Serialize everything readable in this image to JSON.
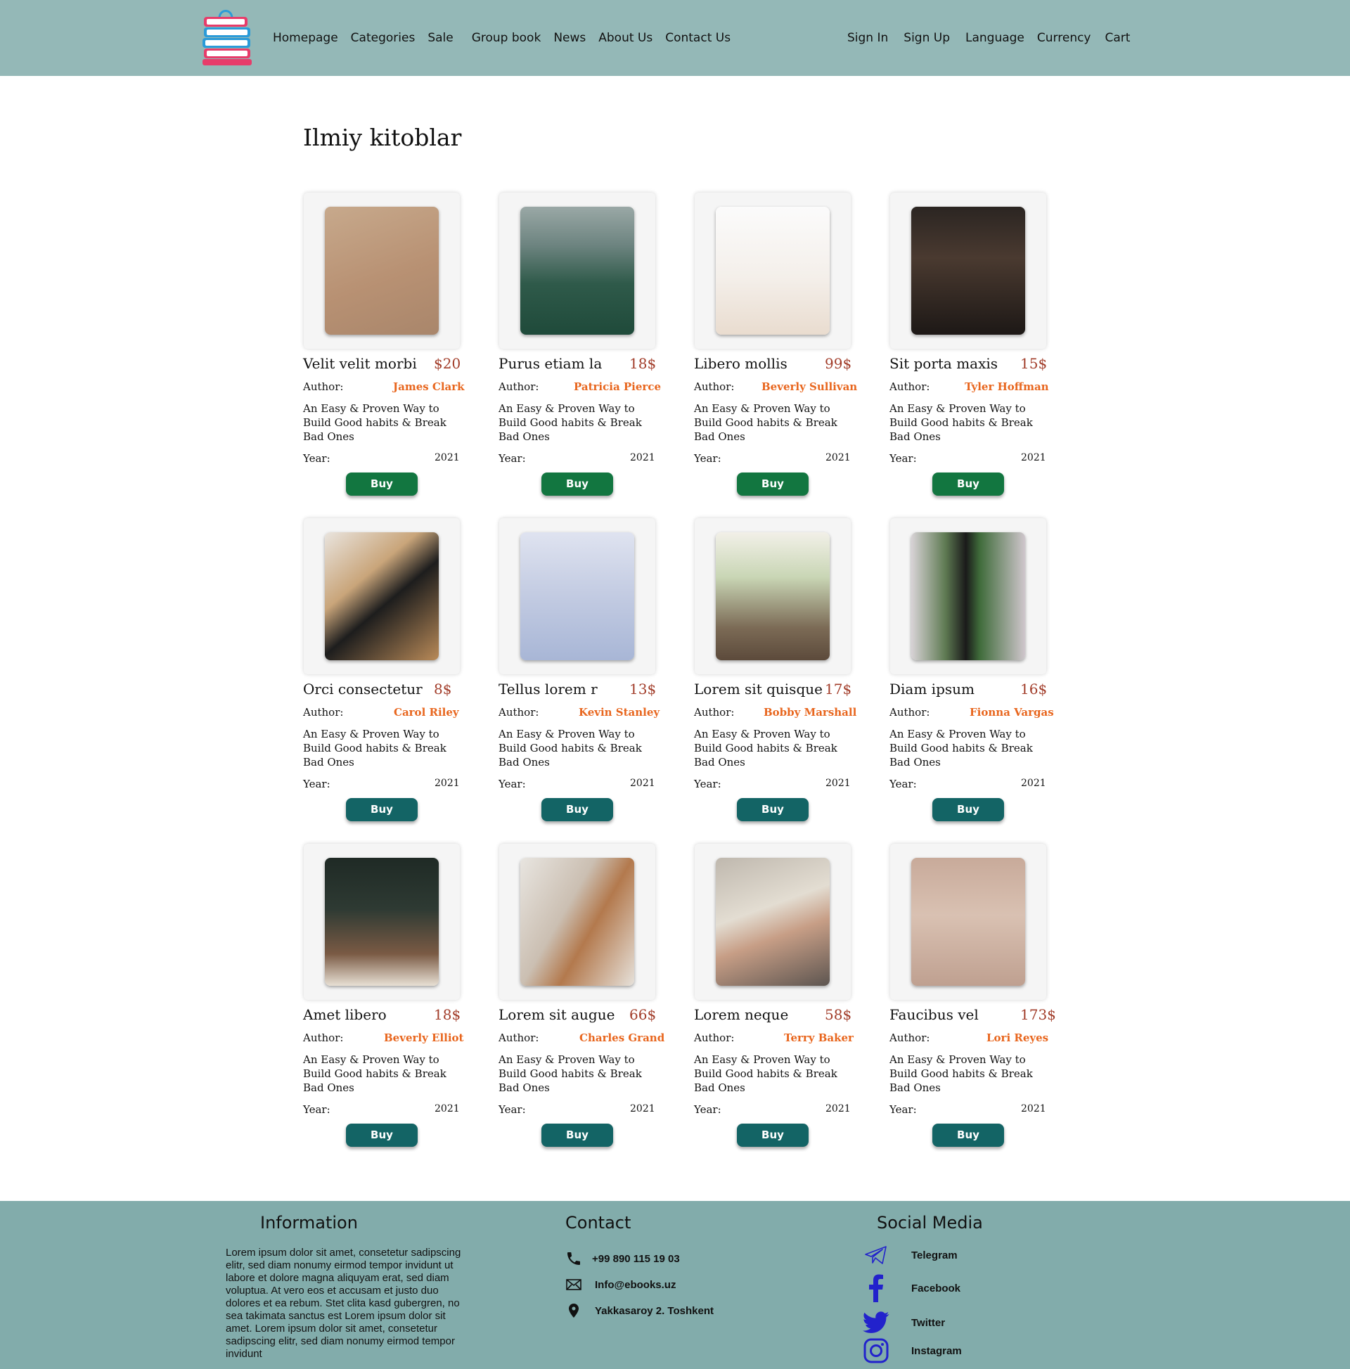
{
  "header": {
    "nav_left": [
      "Homepage",
      "Categories",
      "Sale",
      "Group book",
      "News",
      "About Us",
      "Contact Us"
    ],
    "nav_right": [
      "Sign In",
      "Sign Up",
      "Language",
      "Currency",
      "Cart"
    ]
  },
  "section": {
    "title": "Ilmiy kitoblar"
  },
  "labels": {
    "author": "Author:",
    "year": "Year:",
    "buy": "Buy"
  },
  "books": [
    {
      "title": "Velit velit morbi",
      "price": "$20",
      "author": "James Clark",
      "description": "An Easy & Proven Way to Build Good habits & Break Bad Ones",
      "year": "2021",
      "image": "open-book-on-stack"
    },
    {
      "title": "Purus etiam la",
      "price": "18$",
      "author": "Patricia Pierce",
      "description": "An Easy & Proven Way to Build Good habits & Break Bad Ones",
      "year": "2021",
      "image": "book-over-foggy-forest"
    },
    {
      "title": "Libero mollis",
      "price": "99$",
      "author": "Beverly Sullivan",
      "description": "An Easy & Proven Way to Build Good habits & Break Bad Ones",
      "year": "2021",
      "image": "open-books-white"
    },
    {
      "title": "Sit porta maxis",
      "price": "15$",
      "author": "Tyler Hoffman",
      "description": "An Easy & Proven Way to Build Good habits & Break Bad Ones",
      "year": "2021",
      "image": "dark-library"
    },
    {
      "title": "Orci consectetur",
      "price": "8$",
      "author": "Carol Riley",
      "description": "An Easy & Proven Way to Build Good habits & Break Bad Ones",
      "year": "2021",
      "image": "milk-and-honey-book"
    },
    {
      "title": "Tellus lorem r",
      "price": "13$",
      "author": "Kevin Stanley",
      "description": "An Easy & Proven Way to Build Good habits & Break Bad Ones",
      "year": "2021",
      "image": "open-book-on-bed"
    },
    {
      "title": "Lorem sit quisque",
      "price": "17$",
      "author": "Bobby Marshall",
      "description": "An Easy & Proven Way to Build Good habits & Break Bad Ones",
      "year": "2021",
      "image": "book-by-window"
    },
    {
      "title": "Diam ipsum",
      "price": "16$",
      "author": "Fionna Vargas",
      "description": "An Easy & Proven Way to Build Good habits & Break Bad Ones",
      "year": "2021",
      "image": "window-garden-book"
    },
    {
      "title": "Amet libero",
      "price": "18$",
      "author": "Beverly Elliot",
      "description": "An Easy & Proven Way to Build Good habits & Break Bad Ones",
      "year": "2021",
      "image": "flowers-coffee-book"
    },
    {
      "title": "Lorem sit augue",
      "price": "66$",
      "author": "Charles Grand",
      "description": "An Easy & Proven Way to Build Good habits & Break Bad Ones",
      "year": "2021",
      "image": "curved-library"
    },
    {
      "title": "Lorem neque",
      "price": "58$",
      "author": "Terry Baker",
      "description": "An Easy & Proven Way to Build Good habits & Break Bad Ones",
      "year": "2021",
      "image": "hand-holding-book"
    },
    {
      "title": "Faucibus vel",
      "price": "173$",
      "author": "Lori Reyes",
      "description": "An Easy & Proven Way to Build Good habits & Break Bad Ones",
      "year": "2021",
      "image": "rose-on-open-book"
    }
  ],
  "footer": {
    "information": {
      "heading": "Information",
      "text": "Lorem ipsum dolor sit amet, consetetur sadipscing elitr, sed diam nonumy eirmod tempor invidunt ut labore et dolore magna aliquyam erat, sed diam voluptua. At vero eos et accusam et justo duo dolores et ea rebum. Stet clita kasd gubergren, no sea takimata sanctus est Lorem ipsum dolor sit amet. Lorem ipsum dolor sit amet, consetetur sadipscing elitr, sed diam nonumy eirmod tempor invidunt"
    },
    "contact": {
      "heading": "Contact",
      "phone": "+99 890 115 19 03",
      "email": "Info@ebooks.uz",
      "address": "Yakkasaroy 2. Toshkent"
    },
    "social": {
      "heading": "Social Media",
      "items": [
        "Telegram",
        "Facebook",
        "Twitter",
        "Instagram"
      ]
    }
  },
  "colors": {
    "header_bg": "#94b8b7",
    "footer_bg": "#82acab",
    "buy_button": "#136465",
    "buy_button_first_row": "#127640",
    "price": "#a23d2a",
    "author": "#e8661e",
    "social_icon": "#2222cc"
  }
}
